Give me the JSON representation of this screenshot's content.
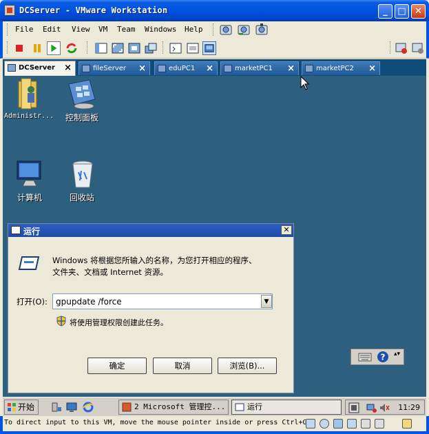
{
  "window": {
    "title": "DCServer - VMware Workstation"
  },
  "menu": {
    "items": [
      "File",
      "Edit",
      "View",
      "VM",
      "Team",
      "Windows",
      "Help"
    ]
  },
  "tabs": [
    {
      "label": "DCServer",
      "active": true
    },
    {
      "label": "fileServer",
      "active": false
    },
    {
      "label": "eduPC1",
      "active": false
    },
    {
      "label": "marketPC1",
      "active": false
    },
    {
      "label": "marketPC2",
      "active": false
    }
  ],
  "desktop": {
    "icons": [
      "Administr...",
      "控制面板",
      "计算机",
      "回收站"
    ]
  },
  "run_dialog": {
    "title": "运行",
    "description_line1": "Windows 将根据您所输入的名称，为您打开相应的程序、",
    "description_line2": "文件夹、文档或 Internet 资源。",
    "open_label": "打开(O):",
    "input_value": "gpupdate /force",
    "admin_note": "将使用管理权限创建此任务。",
    "ok_label": "确定",
    "cancel_label": "取消",
    "browse_label": "浏览(B)..."
  },
  "taskbar": {
    "start_label": "开始",
    "task_mgmt": "2 Microsoft 管理控...",
    "task_run": "运行",
    "clock": "11:29"
  },
  "statusbar": {
    "text": "To direct input to this VM, move the mouse pointer inside or press Ctrl+G."
  }
}
